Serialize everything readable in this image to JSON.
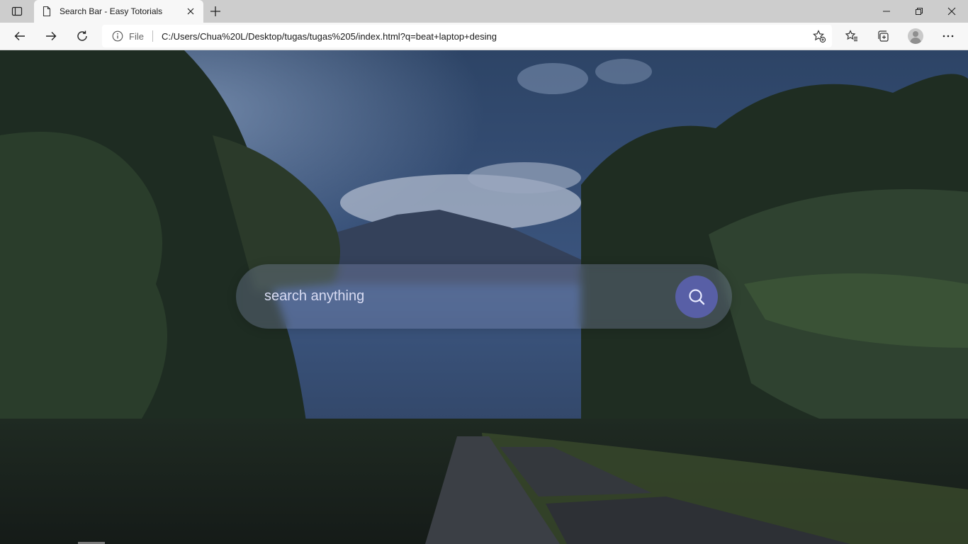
{
  "browser": {
    "tab": {
      "title": "Search Bar - Easy Totorials"
    },
    "address": {
      "scheme": "File",
      "url": "C:/Users/Chua%20L/Desktop/tugas/tugas%205/index.html?q=beat+laptop+desing"
    }
  },
  "page": {
    "search": {
      "placeholder": "search anything",
      "value": ""
    }
  },
  "colors": {
    "search_button": "#585fa6",
    "tab_strip": "#cdcdcd",
    "toolbar": "#f7f7f7"
  }
}
